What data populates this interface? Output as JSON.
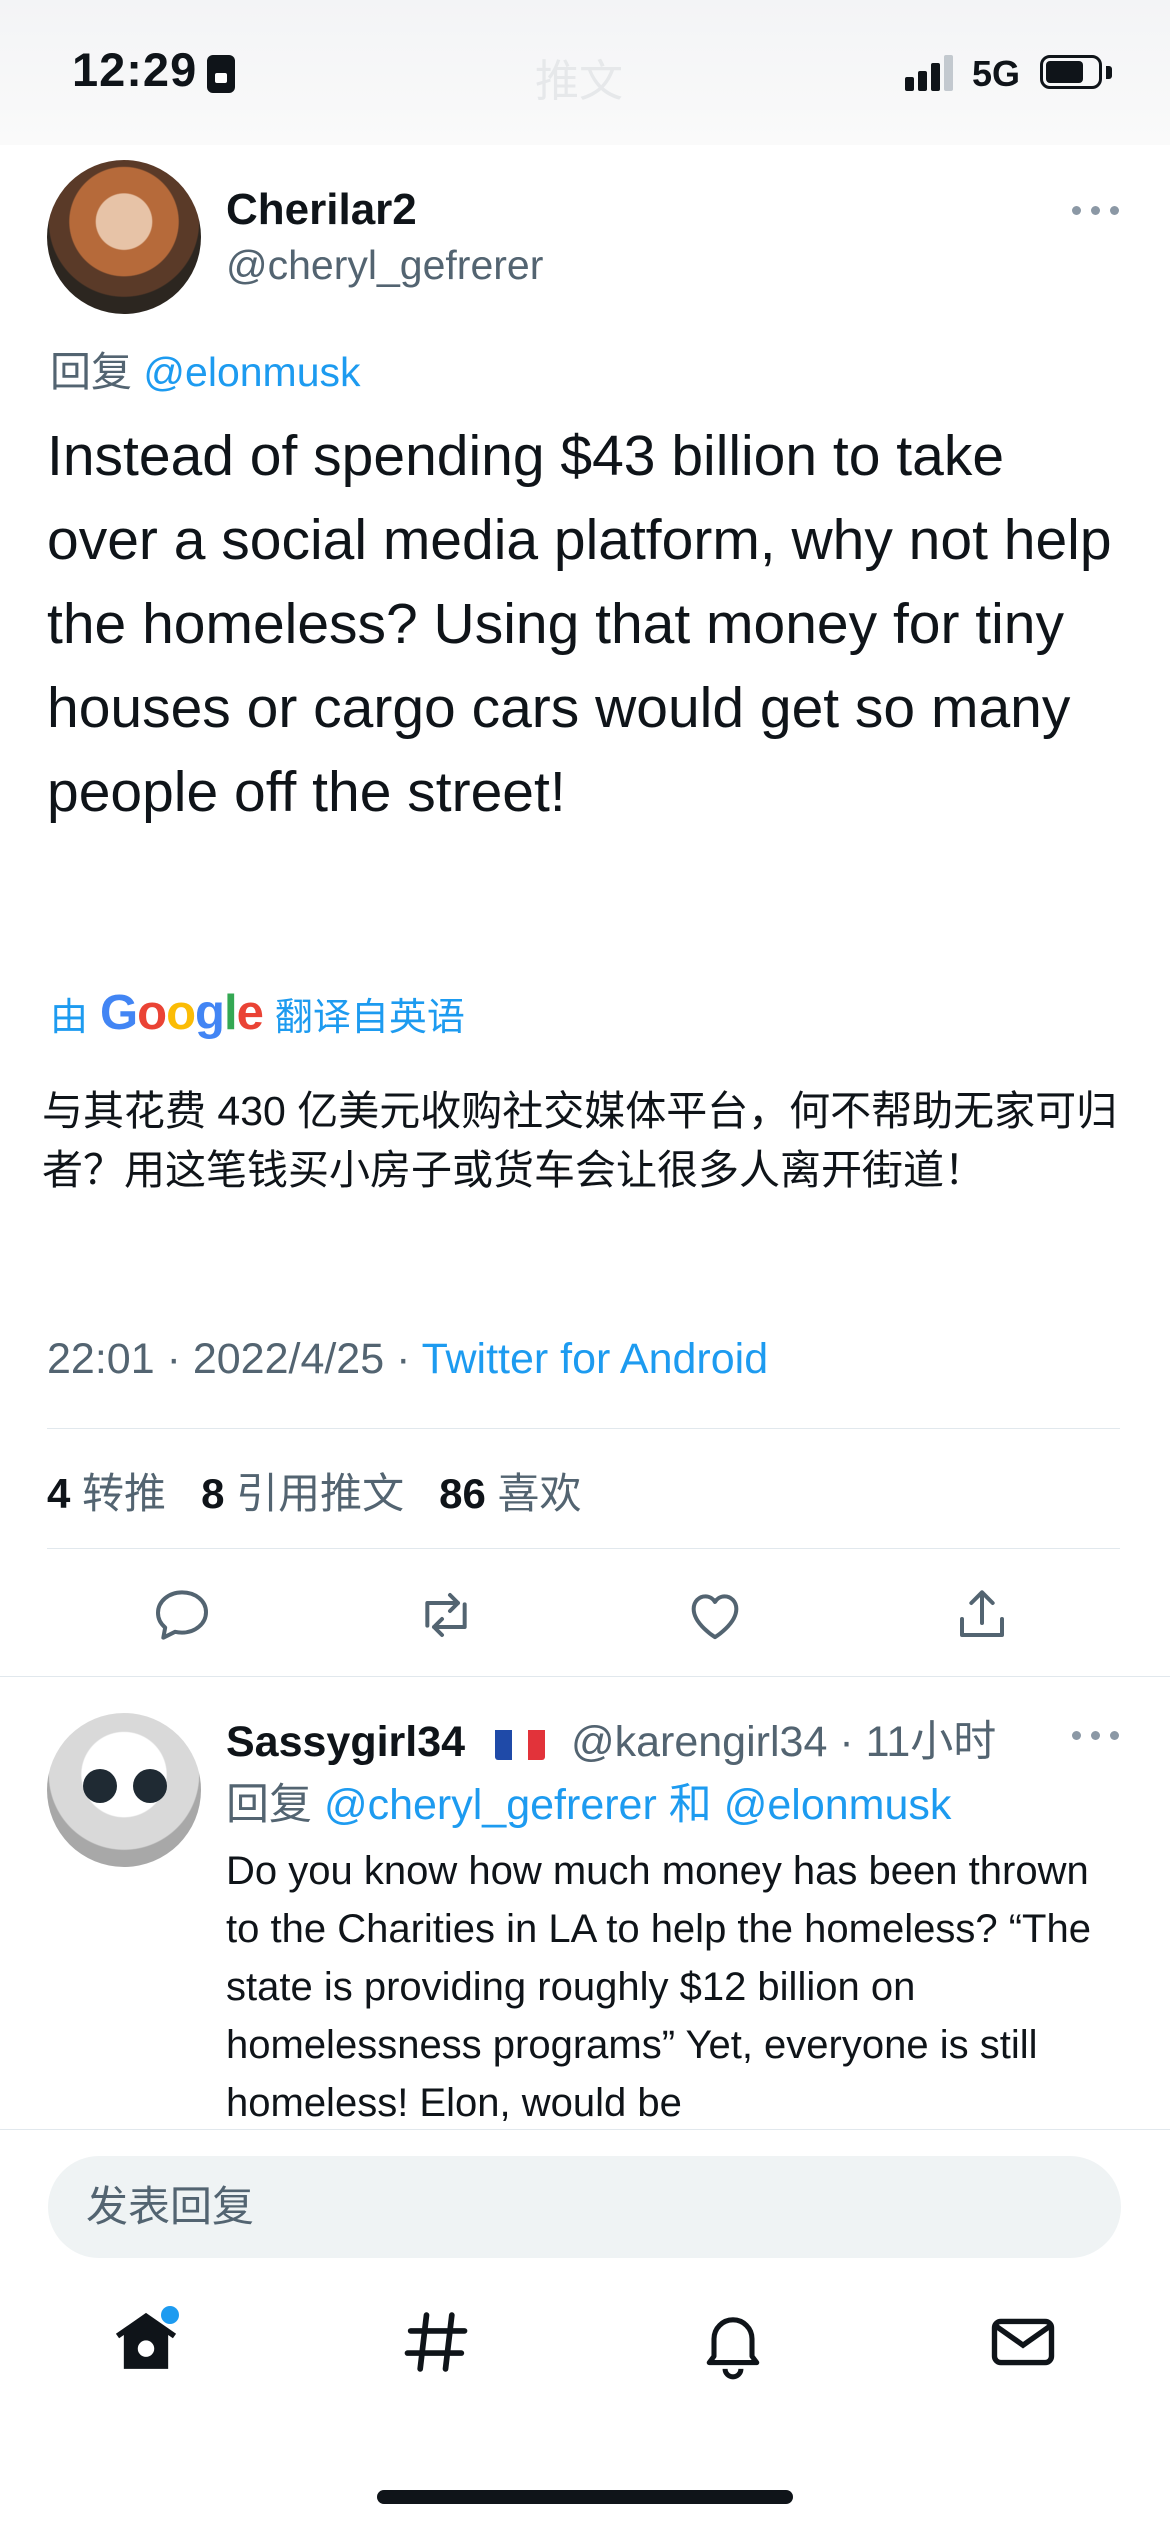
{
  "status_bar": {
    "time": "12:29",
    "faded_title": "推文",
    "network": "5G"
  },
  "tweet": {
    "display_name": "Cherilar2",
    "handle": "@cheryl_gefrerer",
    "reply_prefix": "回复",
    "reply_to": "@elonmusk",
    "text": "Instead of spending $43 billion to take over a social media platform, why not help the homeless? Using that money for tiny houses or cargo cars would get so many people off the street!",
    "translated_by_prefix": "由",
    "translated_by_brand": "Google",
    "translated_by_suffix": "翻译自英语",
    "translation": "与其花费 430 亿美元收购社交媒体平台，何不帮助无家可归者？用这笔钱买小房子或货车会让很多人离开街道！",
    "time": "22:01",
    "date": "2022/4/25",
    "source": "Twitter for Android",
    "stats": {
      "retweets": "4",
      "retweets_label": "转推",
      "quotes": "8",
      "quotes_label": "引用推文",
      "likes": "86",
      "likes_label": "喜欢"
    }
  },
  "reply": {
    "display_name": "Sassygirl34",
    "flag": "🇫🇷",
    "handle": "@karengirl34",
    "time": "11小时",
    "reply_prefix": "回复",
    "reply_to_1": "@cheryl_gefrerer",
    "reply_conjunction": "和",
    "reply_to_2": "@elonmusk",
    "text": "Do you know how much money has been thrown to the Charities in LA to help the homeless? “The state is providing roughly $12 billion on homelessness programs” Yet, everyone is still homeless! Elon, would be"
  },
  "compose": {
    "placeholder": "发表回复"
  },
  "icons": {
    "reply": "reply-icon",
    "retweet": "retweet-icon",
    "like": "like-icon",
    "share": "share-icon",
    "home": "home-icon",
    "explore": "hashtag-icon",
    "notifications": "bell-icon",
    "messages": "mail-icon"
  },
  "colors": {
    "accent": "#1d9bf0",
    "text": "#0f1419",
    "secondary": "#536471"
  }
}
